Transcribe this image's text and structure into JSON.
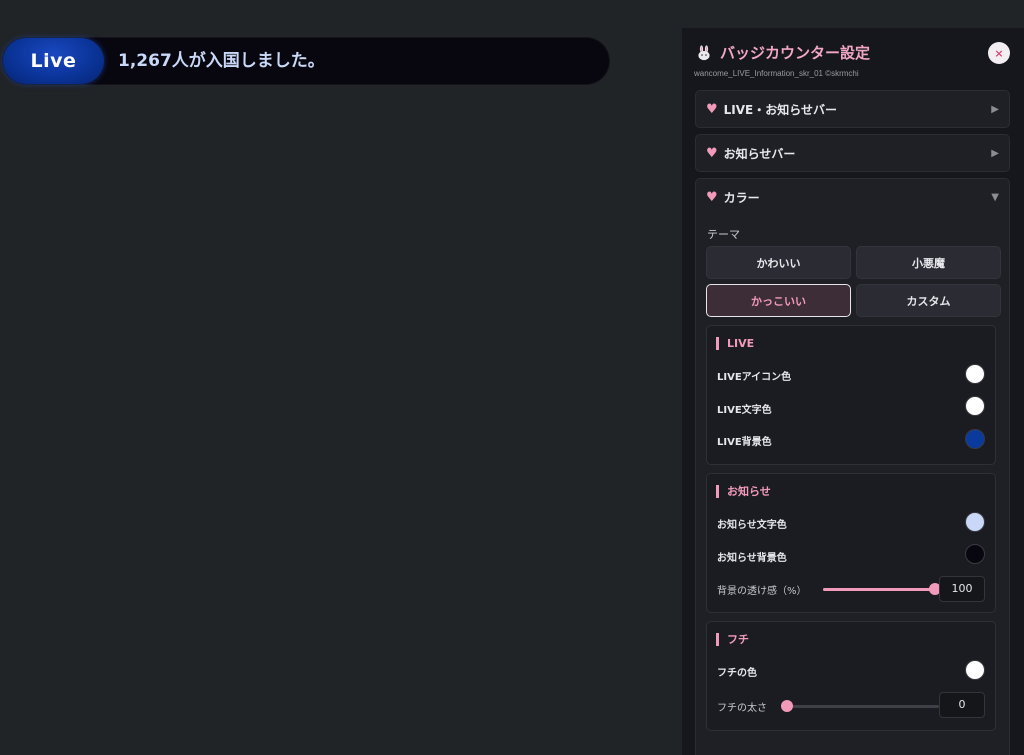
{
  "live_bar": {
    "badge_label": "Live",
    "message": "1,267人が入国しました。"
  },
  "panel": {
    "title": "バッジカウンター設定",
    "subtitle": "wancome_LIVE_Information_skr_01 ©skrmchi",
    "close_label": "×",
    "sections": [
      {
        "label": "LIVE・お知らせバー",
        "state": "collapsed"
      },
      {
        "label": "お知らせバー",
        "state": "collapsed"
      },
      {
        "label": "カラー",
        "state": "expanded"
      }
    ],
    "color": {
      "theme_label": "テーマ",
      "themes": [
        "かわいい",
        "小悪魔",
        "かっこいい",
        "カスタム"
      ],
      "selected_theme": "かっこいい",
      "live": {
        "title": "LIVE",
        "rows": [
          {
            "label": "LIVEアイコン色",
            "color": "#ffffff"
          },
          {
            "label": "LIVE文字色",
            "color": "#ffffff"
          },
          {
            "label": "LIVE背景色",
            "color": "#0a3a9c"
          }
        ]
      },
      "notice": {
        "title": "お知らせ",
        "rows": [
          {
            "label": "お知らせ文字色",
            "color": "#c9d8f7"
          },
          {
            "label": "お知らせ背景色",
            "color": "#08070f"
          }
        ],
        "opacity_label": "背景の透け感（%）",
        "opacity_value": "100"
      },
      "border": {
        "title": "フチ",
        "color_label": "フチの色",
        "color": "#ffffff",
        "width_label": "フチの太さ",
        "width_value": "0"
      }
    }
  },
  "colors": {
    "accent": "#f29ab9",
    "page_bg": "#212427",
    "panel_bg": "#16171c"
  }
}
